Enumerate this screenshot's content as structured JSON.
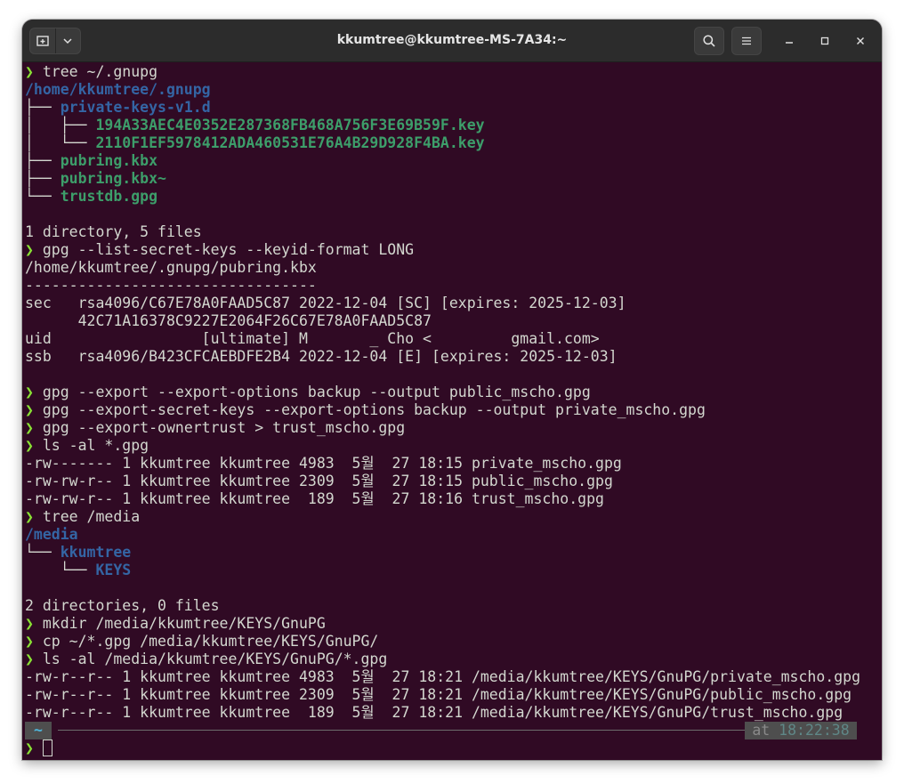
{
  "window": {
    "title": "kkumtree@kkumtree-MS-7A34:~"
  },
  "terminal": {
    "prompt_symbol": "❯",
    "lines": [
      {
        "cmd": "tree ~/.gnupg"
      },
      {
        "dir": "/home/kkumtree/.gnupg"
      },
      {
        "tree": "├── ",
        "dir": "private-keys-v1.d"
      },
      {
        "tree": "│   ├── ",
        "file": "194A33AEC4E0352E287368FB468A756F3E69B59F.key"
      },
      {
        "tree": "│   └── ",
        "file": "2110F1EF5978412ADA460531E76A4B29D928F4BA.key"
      },
      {
        "tree": "├── ",
        "file": "pubring.kbx"
      },
      {
        "tree": "├── ",
        "file": "pubring.kbx~"
      },
      {
        "tree": "└── ",
        "file": "trustdb.gpg"
      },
      {
        "text": ""
      },
      {
        "text": "1 directory, 5 files"
      },
      {
        "cmd": "gpg --list-secret-keys --keyid-format LONG"
      },
      {
        "text": "/home/kkumtree/.gnupg/pubring.kbx"
      },
      {
        "text": "---------------------------------"
      },
      {
        "text": "sec   rsa4096/C67E78A0FAAD5C87 2022-12-04 [SC] [expires: 2025-12-03]"
      },
      {
        "text": "      42C71A16378C9227E2064F26C67E78A0FAAD5C87"
      },
      {
        "text": "uid                 [ultimate] M       _ Cho <         gmail.com>"
      },
      {
        "text": "ssb   rsa4096/B423CFCAEBDFE2B4 2022-12-04 [E] [expires: 2025-12-03]"
      },
      {
        "text": ""
      },
      {
        "cmd": "gpg --export --export-options backup --output public_mscho.gpg"
      },
      {
        "cmd": "gpg --export-secret-keys --export-options backup --output private_mscho.gpg"
      },
      {
        "cmd": "gpg --export-ownertrust > trust_mscho.gpg"
      },
      {
        "cmd": "ls -al *.gpg"
      },
      {
        "text": "-rw------- 1 kkumtree kkumtree 4983  5월  27 18:15 private_mscho.gpg"
      },
      {
        "text": "-rw-rw-r-- 1 kkumtree kkumtree 2309  5월  27 18:15 public_mscho.gpg"
      },
      {
        "text": "-rw-rw-r-- 1 kkumtree kkumtree  189  5월  27 18:16 trust_mscho.gpg"
      },
      {
        "cmd": "tree /media"
      },
      {
        "dir": "/media"
      },
      {
        "tree": "└── ",
        "dir": "kkumtree"
      },
      {
        "tree": "    └── ",
        "dir": "KEYS"
      },
      {
        "text": ""
      },
      {
        "text": "2 directories, 0 files"
      },
      {
        "cmd": "mkdir /media/kkumtree/KEYS/GnuPG"
      },
      {
        "cmd": "cp ~/*.gpg /media/kkumtree/KEYS/GnuPG/"
      },
      {
        "cmd": "ls -al /media/kkumtree/KEYS/GnuPG/*.gpg"
      },
      {
        "text": "-rw-r--r-- 1 kkumtree kkumtree 4983  5월  27 18:21 /media/kkumtree/KEYS/GnuPG/private_mscho.gpg"
      },
      {
        "text": "-rw-r--r-- 1 kkumtree kkumtree 2309  5월  27 18:21 /media/kkumtree/KEYS/GnuPG/public_mscho.gpg"
      },
      {
        "text": "-rw-r--r-- 1 kkumtree kkumtree  189  5월  27 18:21 /media/kkumtree/KEYS/GnuPG/trust_mscho.gpg"
      }
    ],
    "status": {
      "cwd": "~",
      "at": "at",
      "time": "18:22:38"
    },
    "input": ""
  },
  "icons": {
    "new_tab": "new-tab-icon",
    "menu_dropdown": "chevron-down-icon",
    "search": "search-icon",
    "hamburger": "hamburger-menu-icon",
    "minimize": "minimize-icon",
    "maximize": "maximize-icon",
    "close": "close-icon"
  },
  "colors": {
    "terminal_bg": "#300a24",
    "prompt": "#8ae234",
    "directory": "#3465a4",
    "file": "#3d9e6a",
    "text": "#d3d7cf"
  }
}
